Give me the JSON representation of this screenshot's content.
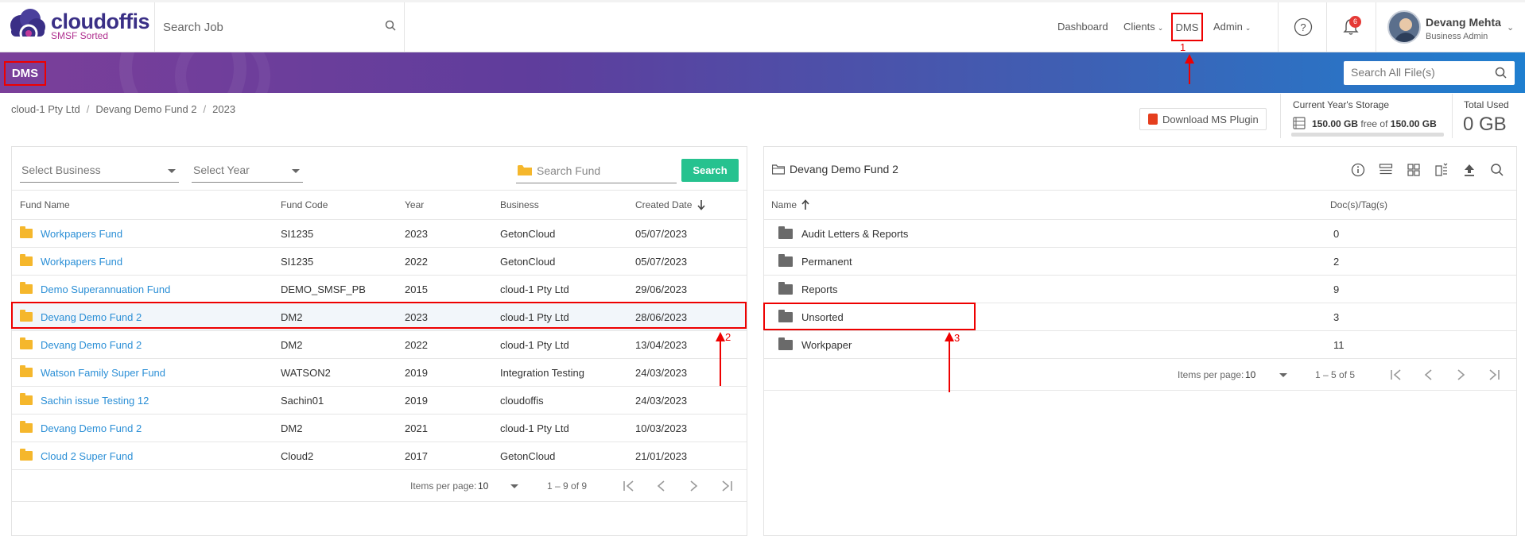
{
  "header": {
    "logo_text": "cloudoffis",
    "logo_sub": "SMSF Sorted",
    "search_placeholder": "Search Job",
    "nav": {
      "dashboard": "Dashboard",
      "clients": "Clients",
      "dms": "DMS",
      "admin": "Admin"
    },
    "notification_count": "6",
    "user_name": "Devang Mehta",
    "user_role": "Business Admin"
  },
  "banner": {
    "title": "DMS",
    "search_placeholder": "Search All File(s)"
  },
  "breadcrumb": [
    "cloud-1 Pty Ltd",
    "Devang Demo Fund 2",
    "2023"
  ],
  "plugin_button": "Download MS Plugin",
  "storage": {
    "title": "Current Year's Storage",
    "free": "150.00 GB",
    "free_of": "free of",
    "total": "150.00 GB",
    "used_fraction": 0.0,
    "total_used_label": "Total Used",
    "total_used_value": "0 GB"
  },
  "left": {
    "select_business": "Select Business",
    "select_year": "Select Year",
    "search_fund_placeholder": "Search Fund",
    "search_button": "Search",
    "columns": [
      "Fund Name",
      "Fund Code",
      "Year",
      "Business",
      "Created Date"
    ],
    "sort_icon": "arrow-down-icon",
    "rows": [
      {
        "name": "Workpapers Fund",
        "code": "SI1235",
        "year": "2023",
        "business": "GetonCloud",
        "created": "05/07/2023"
      },
      {
        "name": "Workpapers Fund",
        "code": "SI1235",
        "year": "2022",
        "business": "GetonCloud",
        "created": "05/07/2023"
      },
      {
        "name": "Demo Superannuation Fund",
        "code": "DEMO_SMSF_PB",
        "year": "2015",
        "business": "cloud-1 Pty Ltd",
        "created": "29/06/2023"
      },
      {
        "name": "Devang Demo Fund 2",
        "code": "DM2",
        "year": "2023",
        "business": "cloud-1 Pty Ltd",
        "created": "28/06/2023"
      },
      {
        "name": "Devang Demo Fund 2",
        "code": "DM2",
        "year": "2022",
        "business": "cloud-1 Pty Ltd",
        "created": "13/04/2023"
      },
      {
        "name": "Watson Family Super Fund",
        "code": "WATSON2",
        "year": "2019",
        "business": "Integration Testing",
        "created": "24/03/2023"
      },
      {
        "name": "Sachin issue Testing 12",
        "code": "Sachin01",
        "year": "2019",
        "business": "cloudoffis",
        "created": "24/03/2023"
      },
      {
        "name": "Devang Demo Fund 2",
        "code": "DM2",
        "year": "2021",
        "business": "cloud-1 Pty Ltd",
        "created": "10/03/2023"
      },
      {
        "name": "Cloud 2 Super Fund",
        "code": "Cloud2",
        "year": "2017",
        "business": "GetonCloud",
        "created": "21/01/2023"
      }
    ],
    "paginator": {
      "label": "Items per page:",
      "size": "10",
      "range": "1 – 9 of 9"
    }
  },
  "right": {
    "title": "Devang Demo Fund 2",
    "columns": [
      "Name",
      "Doc(s)/Tag(s)"
    ],
    "rows": [
      {
        "name": "Audit Letters & Reports",
        "count": "0"
      },
      {
        "name": "Permanent",
        "count": "2"
      },
      {
        "name": "Reports",
        "count": "9"
      },
      {
        "name": "Unsorted",
        "count": "3"
      },
      {
        "name": "Workpaper",
        "count": "11"
      }
    ],
    "paginator": {
      "label": "Items per page:",
      "size": "10",
      "range": "1 – 5 of 5"
    }
  },
  "annotations": {
    "step1": "1",
    "step2": "2",
    "step3": "3",
    "color": "#ee0000"
  },
  "colors": {
    "brand": "#3a2f86",
    "link": "#2b8fd6",
    "search_button": "#26c28f",
    "folder": "#f5b72c"
  }
}
